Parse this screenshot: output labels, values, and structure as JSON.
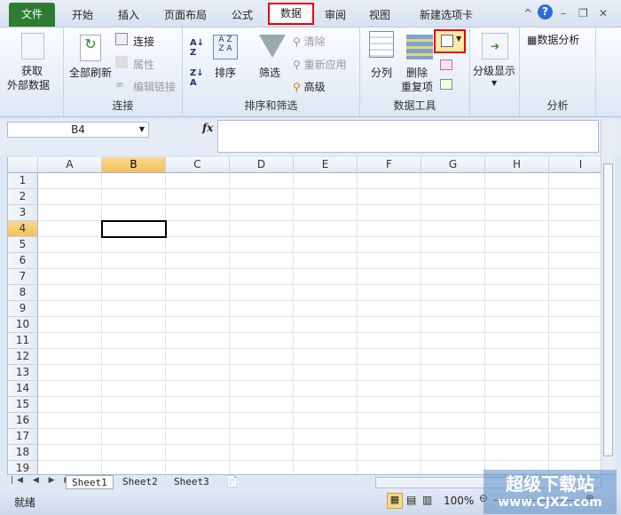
{
  "tabs": {
    "file": "文件",
    "items": [
      "开始",
      "插入",
      "页面布局",
      "公式",
      "数据",
      "审阅",
      "视图",
      "新建选项卡"
    ],
    "active": "数据"
  },
  "ribbon": {
    "get_external": {
      "line1": "获取",
      "line2": "外部数据"
    },
    "connections": {
      "refresh_all": "全部刷新",
      "connections": "连接",
      "properties": "属性",
      "edit_links": "编辑链接",
      "label": "连接"
    },
    "sort_filter": {
      "sort": "排序",
      "filter": "筛选",
      "clear": "清除",
      "reapply": "重新应用",
      "advanced": "高级",
      "label": "排序和筛选"
    },
    "data_tools": {
      "text_to_columns": "分列",
      "remove_dup_1": "删除",
      "remove_dup_2": "重复项",
      "label": "数据工具"
    },
    "outline": {
      "label": "分级显示"
    },
    "analysis": {
      "data_analysis": "数据分析",
      "label": "分析"
    }
  },
  "formula_bar": {
    "name_box": "B4",
    "fx": "fx",
    "value": ""
  },
  "grid": {
    "columns": [
      "A",
      "B",
      "C",
      "D",
      "E",
      "F",
      "G",
      "H",
      "I"
    ],
    "row_count": 19,
    "selected_cell": "B4"
  },
  "sheets": [
    "Sheet1",
    "Sheet2",
    "Sheet3"
  ],
  "active_sheet": "Sheet1",
  "status": {
    "ready": "就绪",
    "zoom": "100%"
  },
  "watermark": {
    "line1": "超级下载站",
    "line2": "www.CJXZ.com"
  }
}
